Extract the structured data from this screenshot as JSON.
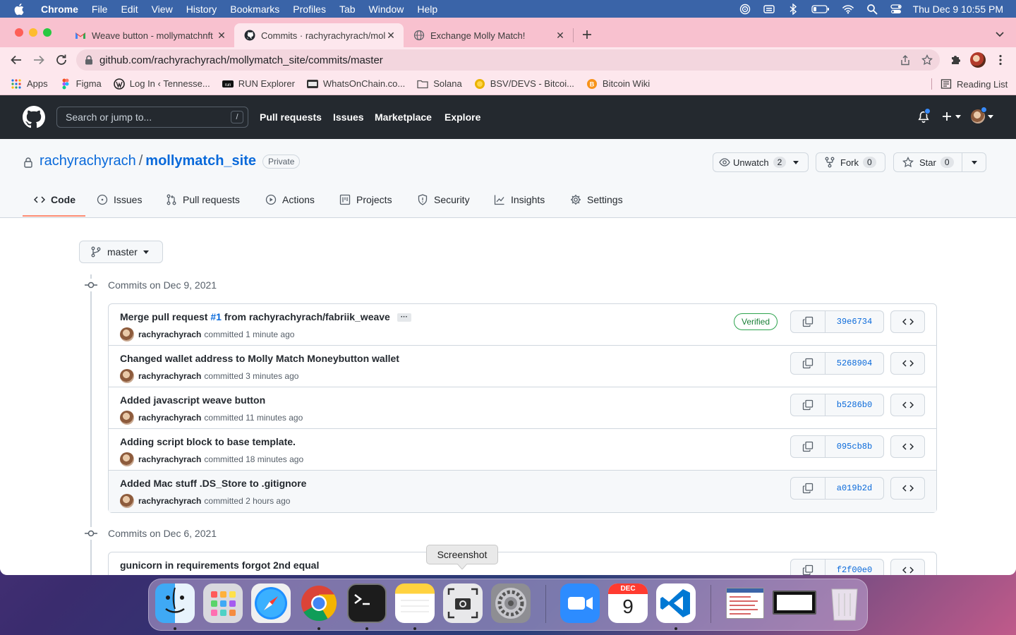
{
  "menubar": {
    "app": "Chrome",
    "items": [
      "File",
      "Edit",
      "View",
      "History",
      "Bookmarks",
      "Profiles",
      "Tab",
      "Window",
      "Help"
    ],
    "clock": "Thu Dec 9  10:55 PM"
  },
  "tabs": [
    {
      "title": "Weave button - mollymatchnft",
      "icon": "gmail-icon"
    },
    {
      "title": "Commits · rachyrachyrach/moll",
      "icon": "github-icon"
    },
    {
      "title": "Exchange Molly Match!",
      "icon": "globe-icon"
    }
  ],
  "url": "github.com/rachyrachyrach/mollymatch_site/commits/master",
  "bookmarks": [
    "Apps",
    "Figma",
    "Log In ‹ Tennesse...",
    "RUN Explorer",
    "WhatsOnChain.co...",
    "Solana",
    "BSV/DEVS - Bitcoi...",
    "Bitcoin Wiki"
  ],
  "reading_list": "Reading List",
  "github": {
    "search_placeholder": "Search or jump to...",
    "search_shortcut": "/",
    "nav": [
      "Pull requests",
      "Issues",
      "Marketplace",
      "Explore"
    ]
  },
  "repo": {
    "owner": "rachyrachyrach",
    "separator": "/",
    "name": "mollymatch_site",
    "visibility": "Private",
    "unwatch_label": "Unwatch",
    "watch_count": "2",
    "fork_label": "Fork",
    "fork_count": "0",
    "star_label": "Star",
    "star_count": "0",
    "tabs": [
      "Code",
      "Issues",
      "Pull requests",
      "Actions",
      "Projects",
      "Security",
      "Insights",
      "Settings"
    ]
  },
  "branch": "master",
  "commit_groups": [
    {
      "date_label": "Commits on Dec 9, 2021",
      "commits": [
        {
          "msg_prefix": "Merge pull request ",
          "pr": "#1",
          "msg_suffix": " from rachyrachyrach/fabriik_weave",
          "has_more": true,
          "more_label": "···",
          "author": "rachyrachyrach",
          "time": "committed 1 minute ago",
          "verified": "Verified",
          "sha": "39e6734"
        },
        {
          "msg_prefix": "Changed wallet address to Molly Match Moneybutton wallet",
          "pr": "",
          "msg_suffix": "",
          "author": "rachyrachyrach",
          "time": "committed 3 minutes ago",
          "sha": "5268904"
        },
        {
          "msg_prefix": "Added javascript weave button",
          "pr": "",
          "msg_suffix": "",
          "author": "rachyrachyrach",
          "time": "committed 11 minutes ago",
          "sha": "b5286b0"
        },
        {
          "msg_prefix": "Adding script block to base template.",
          "pr": "",
          "msg_suffix": "",
          "author": "rachyrachyrach",
          "time": "committed 18 minutes ago",
          "sha": "095cb8b"
        },
        {
          "msg_prefix": "Added Mac stuff .DS_Store to .gitignore",
          "pr": "",
          "msg_suffix": "",
          "author": "rachyrachyrach",
          "time": "committed 2 hours ago",
          "sha": "a019b2d"
        }
      ]
    },
    {
      "date_label": "Commits on Dec 6, 2021",
      "commits": [
        {
          "msg_prefix": "gunicorn in requirements forgot 2nd equal",
          "pr": "",
          "msg_suffix": "",
          "author": "",
          "time": "",
          "sha": "f2f00e0"
        }
      ]
    }
  ],
  "tooltip": "Screenshot",
  "dock": {
    "calendar_month": "DEC",
    "calendar_day": "9"
  },
  "colors": {
    "menubar": "#3a64a8",
    "tabstrip": "#f8c1cf",
    "github_header": "#24292f",
    "link": "#0969da",
    "verified": "#1a7f37"
  }
}
